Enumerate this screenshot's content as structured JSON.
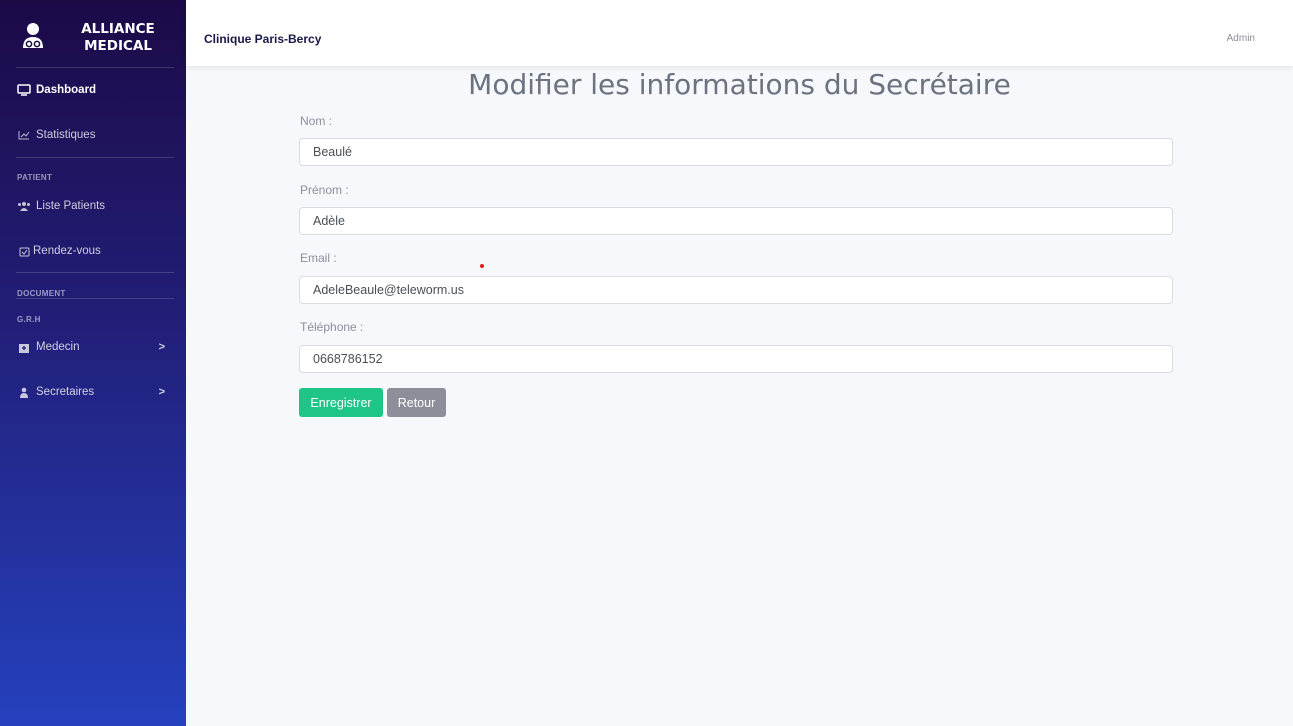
{
  "brand": {
    "line1": "ALLIANCE",
    "line2": "MEDICAL",
    "icon": "doctor-icon"
  },
  "sidebar": {
    "items": [
      {
        "label": "Dashboard",
        "icon": "monitor-icon"
      },
      {
        "label": "Statistiques",
        "icon": "chart-icon"
      },
      {
        "label": "Liste Patients",
        "icon": "users-icon"
      },
      {
        "label": "Rendez-vous",
        "icon": "calendar-check-icon"
      },
      {
        "label": "Medecin",
        "icon": "hospital-icon"
      },
      {
        "label": "Secretaires",
        "icon": "user-icon"
      }
    ],
    "headings": {
      "patient": "PATIENT",
      "document": "DOCUMENT",
      "grh": "G.R.H"
    }
  },
  "topbar": {
    "clinic": "Clinique Paris-Bercy",
    "user": "Admin"
  },
  "page": {
    "title": "Modifier les informations du Secrétaire"
  },
  "form": {
    "nom": {
      "label": "Nom :",
      "value": "Beaulé"
    },
    "prenom": {
      "label": "Prénom :",
      "value": "Adèle"
    },
    "email": {
      "label": "Email :",
      "value": "AdeleBeaule@teleworm.us"
    },
    "telephone": {
      "label": "Téléphone :",
      "value": "0668786152"
    }
  },
  "buttons": {
    "save": "Enregistrer",
    "back": "Retour"
  },
  "colors": {
    "sidebar_top": "#1c0a47",
    "sidebar_bottom": "#2541be",
    "save": "#1fc487",
    "back": "#8c8f99"
  }
}
